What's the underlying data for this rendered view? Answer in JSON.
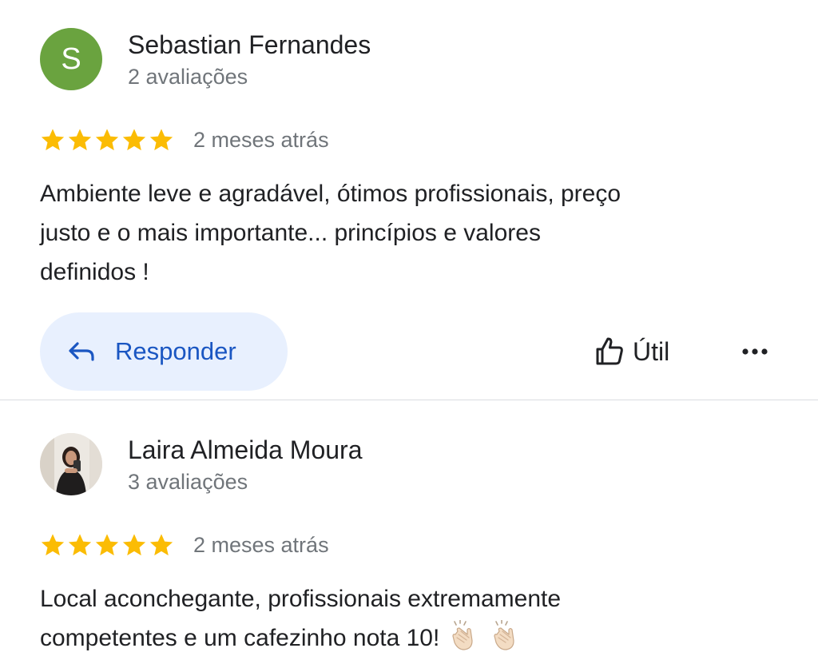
{
  "reviews": [
    {
      "author": {
        "initial": "S",
        "name": "Sebastian Fernandes",
        "review_count": "2 avaliações",
        "avatar_color": "#6aa33f"
      },
      "rating": 5,
      "date": "2 meses atrás",
      "text_lines": [
        "Ambiente leve e agradável, ótimos profissionais, preço",
        "justo e o mais importante...  princípios e valores",
        "definidos !"
      ],
      "actions": {
        "reply_label": "Responder",
        "helpful_label": "Útil"
      }
    },
    {
      "author": {
        "name": "Laira Almeida Moura",
        "review_count": "3 avaliações"
      },
      "rating": 5,
      "date": "2 meses atrás",
      "text_lines": [
        "Local aconchegante, profissionais extremamente",
        "competentes e um cafezinho nota 10!"
      ],
      "emoji": "clapping-hands"
    }
  ],
  "colors": {
    "star": "#fbbc04",
    "reply_bg": "#e8f0fe",
    "reply_text": "#1a56c2",
    "meta_text": "#70757a"
  },
  "icons": {
    "reply": "reply-arrow-icon",
    "helpful": "thumbs-up-icon",
    "more": "more-horizontal-icon"
  }
}
